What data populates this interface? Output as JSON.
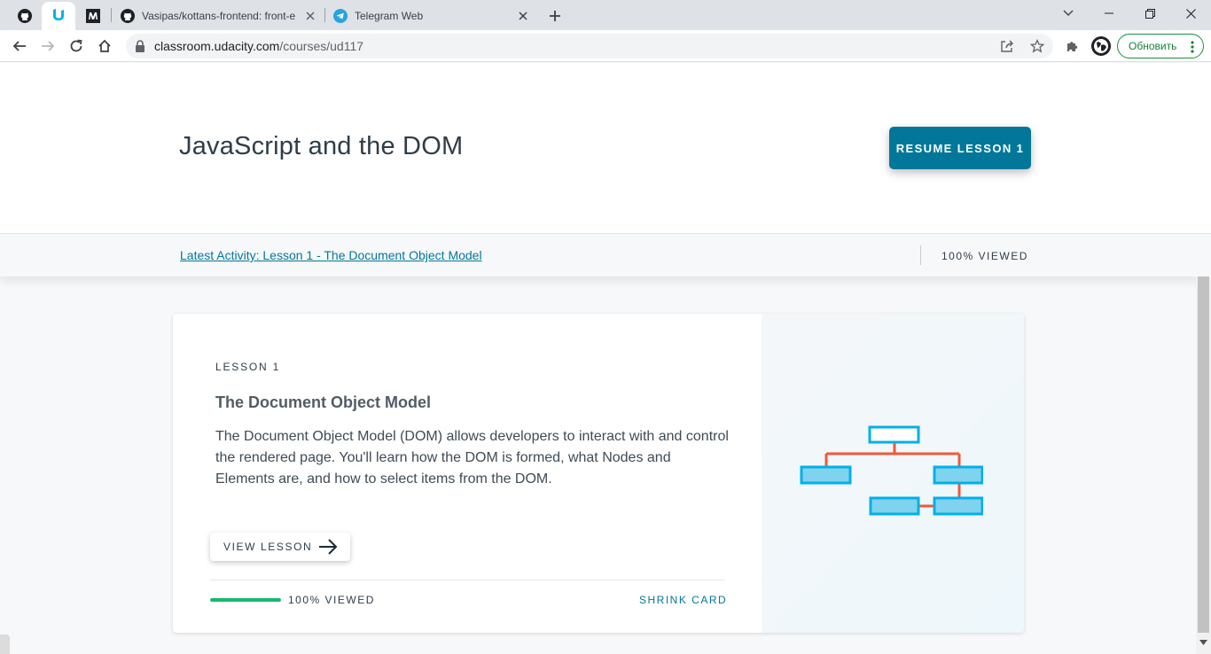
{
  "browser": {
    "tabs": [
      {
        "title": "Vasipas/kottans-frontend: front-e",
        "icon": "github-icon"
      },
      {
        "title": "Telegram Web",
        "icon": "telegram-icon"
      }
    ],
    "pinned_tabs": [
      "github-icon",
      "udacity-icon",
      "medium-icon"
    ],
    "url_host": "classroom.udacity.com",
    "url_path": "/courses/ud117",
    "update_label": "Обновить"
  },
  "header": {
    "title": "JavaScript and the DOM",
    "resume_label": "RESUME LESSON 1"
  },
  "activity": {
    "link_text": "Latest Activity: Lesson 1 - The Document Object Model",
    "viewed": "100% VIEWED"
  },
  "lesson_card": {
    "kicker": "LESSON 1",
    "title": "The Document Object Model",
    "description": "The Document Object Model (DOM) allows developers to interact with and control the rendered page. You'll learn how the DOM is formed, what Nodes and Elements are, and how to select items from the DOM.",
    "view_label": "VIEW LESSON",
    "progress_fraction": 1.0,
    "viewed": "100% VIEWED",
    "shrink_label": "SHRINK CARD"
  },
  "colors": {
    "accent": "#02779a",
    "progress": "#14b86e",
    "update_green": "#188038",
    "diagram_box": "#00b0e6",
    "diagram_line": "#f05a3a"
  }
}
